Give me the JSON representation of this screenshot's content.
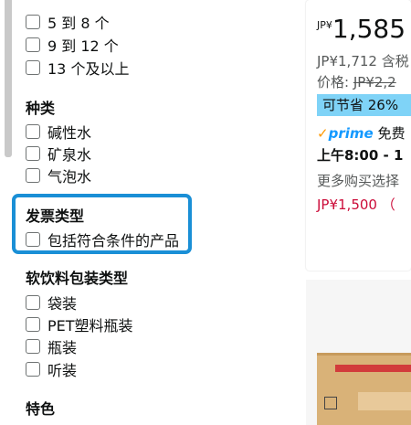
{
  "filters": {
    "count_options": [
      "5 到 8 个",
      "9 到 12 个",
      "13 个及以上"
    ],
    "type_heading": "种类",
    "type_options": [
      "碱性水",
      "矿泉水",
      "气泡水"
    ],
    "invoice_heading": "发票类型",
    "invoice_options": [
      "包括符合条件的产品"
    ],
    "package_heading": "软饮料包装类型",
    "package_options": [
      "袋装",
      "PET塑料瓶装",
      "瓶装",
      "听装"
    ],
    "feature_heading": "特色"
  },
  "product": {
    "currency": "JP¥",
    "price": "1,585",
    "tax_line": "JP¥1,712 含税",
    "list_price_label": "价格:",
    "list_price": "JP¥2,2",
    "savings": "可节省 26%",
    "prime_check": "✓",
    "prime_label": "prime",
    "prime_suffix": "免费",
    "delivery": "上午8:00 - 1",
    "more_options": "更多购买选择",
    "other_price": "JP¥1,500 （"
  },
  "colors": {
    "highlight_border": "#1a8fd6",
    "savings_badge": "#7fd3f7",
    "prime_blue": "#1399ff",
    "deal_red": "#cc0c39"
  }
}
